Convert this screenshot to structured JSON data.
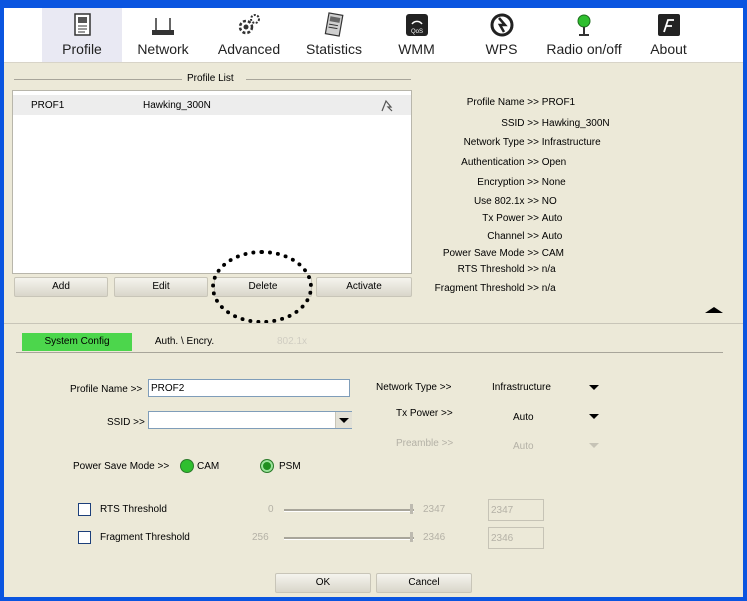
{
  "toolbar": {
    "items": [
      {
        "label": "Profile",
        "icon": "profile-icon"
      },
      {
        "label": "Network",
        "icon": "router-icon"
      },
      {
        "label": "Advanced",
        "icon": "gears-icon"
      },
      {
        "label": "Statistics",
        "icon": "statistics-icon"
      },
      {
        "label": "WMM",
        "icon": "qos-icon"
      },
      {
        "label": "WPS",
        "icon": "wps-icon"
      },
      {
        "label": "Radio on/off",
        "icon": "radio-icon"
      },
      {
        "label": "About",
        "icon": "about-icon"
      }
    ]
  },
  "profile_list": {
    "title": "Profile List",
    "rows": [
      {
        "name": "PROF1",
        "ssid": "Hawking_300N"
      }
    ],
    "buttons": {
      "add": "Add",
      "edit": "Edit",
      "delete": "Delete",
      "activate": "Activate"
    }
  },
  "profile_info": [
    {
      "label": "Profile Name >>",
      "value": "PROF1"
    },
    {
      "label": "SSID >>",
      "value": "Hawking_300N"
    },
    {
      "label": "Network Type >>",
      "value": "Infrastructure"
    },
    {
      "label": "Authentication >>",
      "value": "Open"
    },
    {
      "label": "Encryption >>",
      "value": "None"
    },
    {
      "label": "Use 802.1x >>",
      "value": "NO"
    },
    {
      "label": "Tx Power >>",
      "value": "Auto"
    },
    {
      "label": "Channel >>",
      "value": "Auto"
    },
    {
      "label": "Power Save Mode >>",
      "value": "CAM"
    },
    {
      "label": "RTS Threshold >>",
      "value": "n/a"
    },
    {
      "label": "Fragment Threshold >>",
      "value": "n/a"
    }
  ],
  "tabs": [
    {
      "label": "System Config"
    },
    {
      "label": "Auth. \\ Encry."
    },
    {
      "label": "802.1x"
    }
  ],
  "config": {
    "profile_name_label": "Profile Name >>",
    "profile_name_value": "PROF2",
    "ssid_label": "SSID >>",
    "ssid_value": "",
    "network_type_label": "Network Type >>",
    "network_type_value": "Infrastructure",
    "tx_power_label": "Tx Power >>",
    "tx_power_value": "Auto",
    "preamble_label": "Preamble >>",
    "preamble_value": "Auto",
    "power_save_label": "Power Save Mode >>",
    "cam_label": "CAM",
    "psm_label": "PSM",
    "rts_label": "RTS Threshold",
    "rts_min": "0",
    "rts_max": "2347",
    "rts_value": "2347",
    "frag_label": "Fragment Threshold",
    "frag_min": "256",
    "frag_max": "2346",
    "frag_value": "2346"
  },
  "footer": {
    "ok": "OK",
    "cancel": "Cancel"
  },
  "colors": {
    "titlebar": "#0a55e0",
    "panel": "#ece9d8",
    "active_tab": "#4cd64c"
  }
}
